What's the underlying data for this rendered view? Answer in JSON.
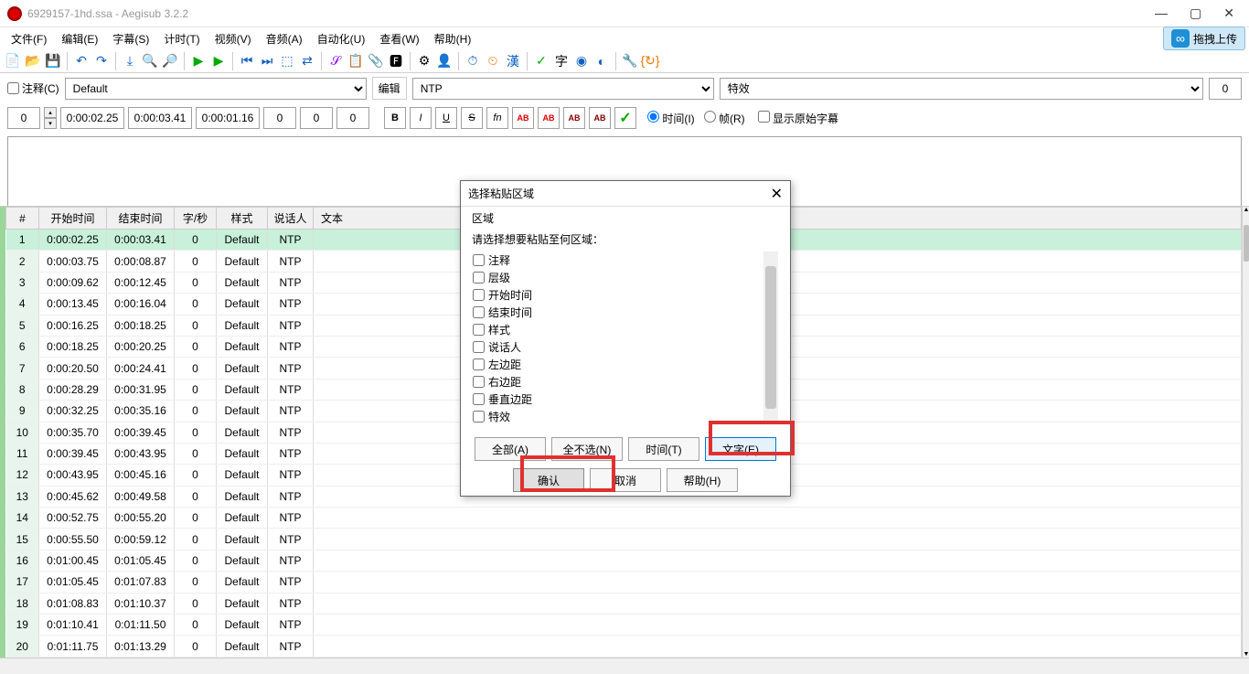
{
  "title": "6929157-1hd.ssa - Aegisub 3.2.2",
  "menus": [
    "文件(F)",
    "编辑(E)",
    "字幕(S)",
    "计时(T)",
    "视频(V)",
    "音频(A)",
    "自动化(U)",
    "查看(W)",
    "帮助(H)"
  ],
  "upload_label": "拖拽上传",
  "selectrow": {
    "annotate_label": "注释(C)",
    "style_value": "Default",
    "editor_label": "编辑",
    "actor_value": "NTP",
    "effect_placeholder": "特效",
    "count": "0"
  },
  "editrow": {
    "layer": "0",
    "start": "0:00:02.25",
    "end": "0:00:03.41",
    "dur": "0:00:01.16",
    "ml": "0",
    "mr": "0",
    "mv": "0",
    "btns": {
      "B": "B",
      "I": "I",
      "U": "U",
      "S": "S",
      "fn": "fn",
      "AB1": "AB",
      "AB2": "AB",
      "AB3": "AB",
      "AB4": "AB",
      "check": "✓"
    },
    "time_label": "时间(I)",
    "frame_label": "帧(R)",
    "orig_label": "显示原始字幕"
  },
  "grid": {
    "headers": [
      "#",
      "开始时间",
      "结束时间",
      "字/秒",
      "样式",
      "说话人",
      "文本"
    ],
    "rows": [
      {
        "n": 1,
        "s": "0:00:02.25",
        "e": "0:00:03.41",
        "cps": "0",
        "st": "Default",
        "a": "NTP",
        "sel": true
      },
      {
        "n": 2,
        "s": "0:00:03.75",
        "e": "0:00:08.87",
        "cps": "0",
        "st": "Default",
        "a": "NTP"
      },
      {
        "n": 3,
        "s": "0:00:09.62",
        "e": "0:00:12.45",
        "cps": "0",
        "st": "Default",
        "a": "NTP"
      },
      {
        "n": 4,
        "s": "0:00:13.45",
        "e": "0:00:16.04",
        "cps": "0",
        "st": "Default",
        "a": "NTP"
      },
      {
        "n": 5,
        "s": "0:00:16.25",
        "e": "0:00:18.25",
        "cps": "0",
        "st": "Default",
        "a": "NTP"
      },
      {
        "n": 6,
        "s": "0:00:18.25",
        "e": "0:00:20.25",
        "cps": "0",
        "st": "Default",
        "a": "NTP"
      },
      {
        "n": 7,
        "s": "0:00:20.50",
        "e": "0:00:24.41",
        "cps": "0",
        "st": "Default",
        "a": "NTP"
      },
      {
        "n": 8,
        "s": "0:00:28.29",
        "e": "0:00:31.95",
        "cps": "0",
        "st": "Default",
        "a": "NTP"
      },
      {
        "n": 9,
        "s": "0:00:32.25",
        "e": "0:00:35.16",
        "cps": "0",
        "st": "Default",
        "a": "NTP"
      },
      {
        "n": 10,
        "s": "0:00:35.70",
        "e": "0:00:39.45",
        "cps": "0",
        "st": "Default",
        "a": "NTP"
      },
      {
        "n": 11,
        "s": "0:00:39.45",
        "e": "0:00:43.95",
        "cps": "0",
        "st": "Default",
        "a": "NTP"
      },
      {
        "n": 12,
        "s": "0:00:43.95",
        "e": "0:00:45.16",
        "cps": "0",
        "st": "Default",
        "a": "NTP"
      },
      {
        "n": 13,
        "s": "0:00:45.62",
        "e": "0:00:49.58",
        "cps": "0",
        "st": "Default",
        "a": "NTP"
      },
      {
        "n": 14,
        "s": "0:00:52.75",
        "e": "0:00:55.20",
        "cps": "0",
        "st": "Default",
        "a": "NTP"
      },
      {
        "n": 15,
        "s": "0:00:55.50",
        "e": "0:00:59.12",
        "cps": "0",
        "st": "Default",
        "a": "NTP"
      },
      {
        "n": 16,
        "s": "0:01:00.45",
        "e": "0:01:05.45",
        "cps": "0",
        "st": "Default",
        "a": "NTP"
      },
      {
        "n": 17,
        "s": "0:01:05.45",
        "e": "0:01:07.83",
        "cps": "0",
        "st": "Default",
        "a": "NTP"
      },
      {
        "n": 18,
        "s": "0:01:08.83",
        "e": "0:01:10.37",
        "cps": "0",
        "st": "Default",
        "a": "NTP"
      },
      {
        "n": 19,
        "s": "0:01:10.41",
        "e": "0:01:11.50",
        "cps": "0",
        "st": "Default",
        "a": "NTP"
      },
      {
        "n": 20,
        "s": "0:01:11.75",
        "e": "0:01:13.29",
        "cps": "0",
        "st": "Default",
        "a": "NTP"
      }
    ]
  },
  "dialog": {
    "title": "选择粘贴区域",
    "group": "区域",
    "instr": "请选择想要粘贴至何区域：",
    "items": [
      "注释",
      "层级",
      "开始时间",
      "结束时间",
      "样式",
      "说话人",
      "左边距",
      "右边距",
      "垂直边距",
      "特效"
    ],
    "btns_top": {
      "all": "全部(A)",
      "none": "全不选(N)",
      "time": "时间(T)",
      "text": "文字(E)"
    },
    "btns_bot": {
      "ok": "确认",
      "cancel": "取消",
      "help": "帮助(H)"
    }
  }
}
